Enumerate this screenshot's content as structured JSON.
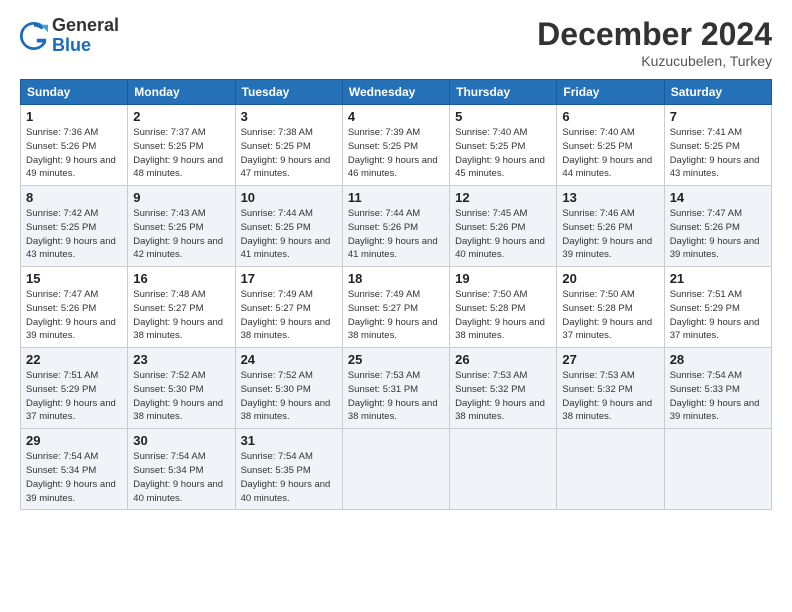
{
  "header": {
    "logo_line1": "General",
    "logo_line2": "Blue",
    "month_title": "December 2024",
    "location": "Kuzucubelen, Turkey"
  },
  "days_of_week": [
    "Sunday",
    "Monday",
    "Tuesday",
    "Wednesday",
    "Thursday",
    "Friday",
    "Saturday"
  ],
  "weeks": [
    [
      {
        "day": "1",
        "sunrise": "Sunrise: 7:36 AM",
        "sunset": "Sunset: 5:26 PM",
        "daylight": "Daylight: 9 hours and 49 minutes."
      },
      {
        "day": "2",
        "sunrise": "Sunrise: 7:37 AM",
        "sunset": "Sunset: 5:25 PM",
        "daylight": "Daylight: 9 hours and 48 minutes."
      },
      {
        "day": "3",
        "sunrise": "Sunrise: 7:38 AM",
        "sunset": "Sunset: 5:25 PM",
        "daylight": "Daylight: 9 hours and 47 minutes."
      },
      {
        "day": "4",
        "sunrise": "Sunrise: 7:39 AM",
        "sunset": "Sunset: 5:25 PM",
        "daylight": "Daylight: 9 hours and 46 minutes."
      },
      {
        "day": "5",
        "sunrise": "Sunrise: 7:40 AM",
        "sunset": "Sunset: 5:25 PM",
        "daylight": "Daylight: 9 hours and 45 minutes."
      },
      {
        "day": "6",
        "sunrise": "Sunrise: 7:40 AM",
        "sunset": "Sunset: 5:25 PM",
        "daylight": "Daylight: 9 hours and 44 minutes."
      },
      {
        "day": "7",
        "sunrise": "Sunrise: 7:41 AM",
        "sunset": "Sunset: 5:25 PM",
        "daylight": "Daylight: 9 hours and 43 minutes."
      }
    ],
    [
      {
        "day": "8",
        "sunrise": "Sunrise: 7:42 AM",
        "sunset": "Sunset: 5:25 PM",
        "daylight": "Daylight: 9 hours and 43 minutes."
      },
      {
        "day": "9",
        "sunrise": "Sunrise: 7:43 AM",
        "sunset": "Sunset: 5:25 PM",
        "daylight": "Daylight: 9 hours and 42 minutes."
      },
      {
        "day": "10",
        "sunrise": "Sunrise: 7:44 AM",
        "sunset": "Sunset: 5:25 PM",
        "daylight": "Daylight: 9 hours and 41 minutes."
      },
      {
        "day": "11",
        "sunrise": "Sunrise: 7:44 AM",
        "sunset": "Sunset: 5:26 PM",
        "daylight": "Daylight: 9 hours and 41 minutes."
      },
      {
        "day": "12",
        "sunrise": "Sunrise: 7:45 AM",
        "sunset": "Sunset: 5:26 PM",
        "daylight": "Daylight: 9 hours and 40 minutes."
      },
      {
        "day": "13",
        "sunrise": "Sunrise: 7:46 AM",
        "sunset": "Sunset: 5:26 PM",
        "daylight": "Daylight: 9 hours and 39 minutes."
      },
      {
        "day": "14",
        "sunrise": "Sunrise: 7:47 AM",
        "sunset": "Sunset: 5:26 PM",
        "daylight": "Daylight: 9 hours and 39 minutes."
      }
    ],
    [
      {
        "day": "15",
        "sunrise": "Sunrise: 7:47 AM",
        "sunset": "Sunset: 5:26 PM",
        "daylight": "Daylight: 9 hours and 39 minutes."
      },
      {
        "day": "16",
        "sunrise": "Sunrise: 7:48 AM",
        "sunset": "Sunset: 5:27 PM",
        "daylight": "Daylight: 9 hours and 38 minutes."
      },
      {
        "day": "17",
        "sunrise": "Sunrise: 7:49 AM",
        "sunset": "Sunset: 5:27 PM",
        "daylight": "Daylight: 9 hours and 38 minutes."
      },
      {
        "day": "18",
        "sunrise": "Sunrise: 7:49 AM",
        "sunset": "Sunset: 5:27 PM",
        "daylight": "Daylight: 9 hours and 38 minutes."
      },
      {
        "day": "19",
        "sunrise": "Sunrise: 7:50 AM",
        "sunset": "Sunset: 5:28 PM",
        "daylight": "Daylight: 9 hours and 38 minutes."
      },
      {
        "day": "20",
        "sunrise": "Sunrise: 7:50 AM",
        "sunset": "Sunset: 5:28 PM",
        "daylight": "Daylight: 9 hours and 37 minutes."
      },
      {
        "day": "21",
        "sunrise": "Sunrise: 7:51 AM",
        "sunset": "Sunset: 5:29 PM",
        "daylight": "Daylight: 9 hours and 37 minutes."
      }
    ],
    [
      {
        "day": "22",
        "sunrise": "Sunrise: 7:51 AM",
        "sunset": "Sunset: 5:29 PM",
        "daylight": "Daylight: 9 hours and 37 minutes."
      },
      {
        "day": "23",
        "sunrise": "Sunrise: 7:52 AM",
        "sunset": "Sunset: 5:30 PM",
        "daylight": "Daylight: 9 hours and 38 minutes."
      },
      {
        "day": "24",
        "sunrise": "Sunrise: 7:52 AM",
        "sunset": "Sunset: 5:30 PM",
        "daylight": "Daylight: 9 hours and 38 minutes."
      },
      {
        "day": "25",
        "sunrise": "Sunrise: 7:53 AM",
        "sunset": "Sunset: 5:31 PM",
        "daylight": "Daylight: 9 hours and 38 minutes."
      },
      {
        "day": "26",
        "sunrise": "Sunrise: 7:53 AM",
        "sunset": "Sunset: 5:32 PM",
        "daylight": "Daylight: 9 hours and 38 minutes."
      },
      {
        "day": "27",
        "sunrise": "Sunrise: 7:53 AM",
        "sunset": "Sunset: 5:32 PM",
        "daylight": "Daylight: 9 hours and 38 minutes."
      },
      {
        "day": "28",
        "sunrise": "Sunrise: 7:54 AM",
        "sunset": "Sunset: 5:33 PM",
        "daylight": "Daylight: 9 hours and 39 minutes."
      }
    ],
    [
      {
        "day": "29",
        "sunrise": "Sunrise: 7:54 AM",
        "sunset": "Sunset: 5:34 PM",
        "daylight": "Daylight: 9 hours and 39 minutes."
      },
      {
        "day": "30",
        "sunrise": "Sunrise: 7:54 AM",
        "sunset": "Sunset: 5:34 PM",
        "daylight": "Daylight: 9 hours and 40 minutes."
      },
      {
        "day": "31",
        "sunrise": "Sunrise: 7:54 AM",
        "sunset": "Sunset: 5:35 PM",
        "daylight": "Daylight: 9 hours and 40 minutes."
      },
      null,
      null,
      null,
      null
    ]
  ]
}
